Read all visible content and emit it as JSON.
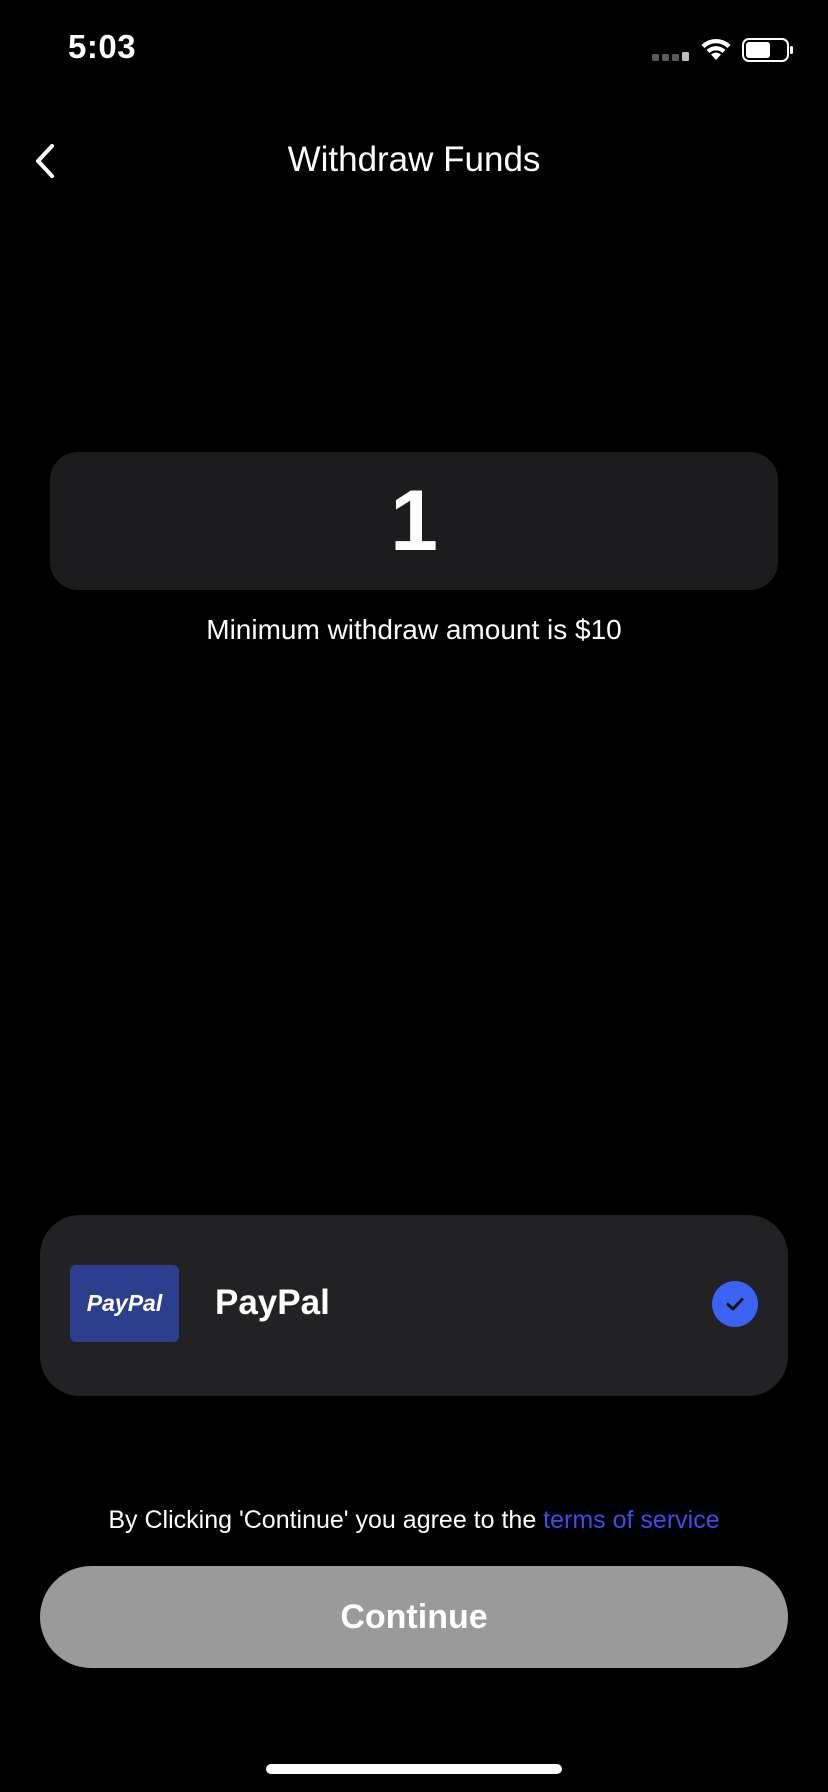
{
  "status_bar": {
    "time": "5:03",
    "icons": [
      "cellular-signal-icon",
      "wifi-icon",
      "battery-icon"
    ]
  },
  "nav": {
    "back_icon": "chevron-left-icon",
    "title": "Withdraw Funds"
  },
  "amount": {
    "value": "1",
    "minimum_note": "Minimum withdraw amount is $10"
  },
  "payment_method": {
    "logo_text": "PayPal",
    "name": "PayPal",
    "selected": true,
    "check_icon": "checkmark-icon"
  },
  "terms": {
    "prefix": "By Clicking 'Continue' you agree to the ",
    "link_text": "terms of service"
  },
  "continue_button": {
    "label": "Continue"
  },
  "colors": {
    "background": "#000000",
    "card": "#1c1c1e",
    "accent": "#3b63f3",
    "link": "#3d4cf0",
    "button_disabled": "#9a9a9a",
    "paypal_brand": "#2c3e8e"
  }
}
